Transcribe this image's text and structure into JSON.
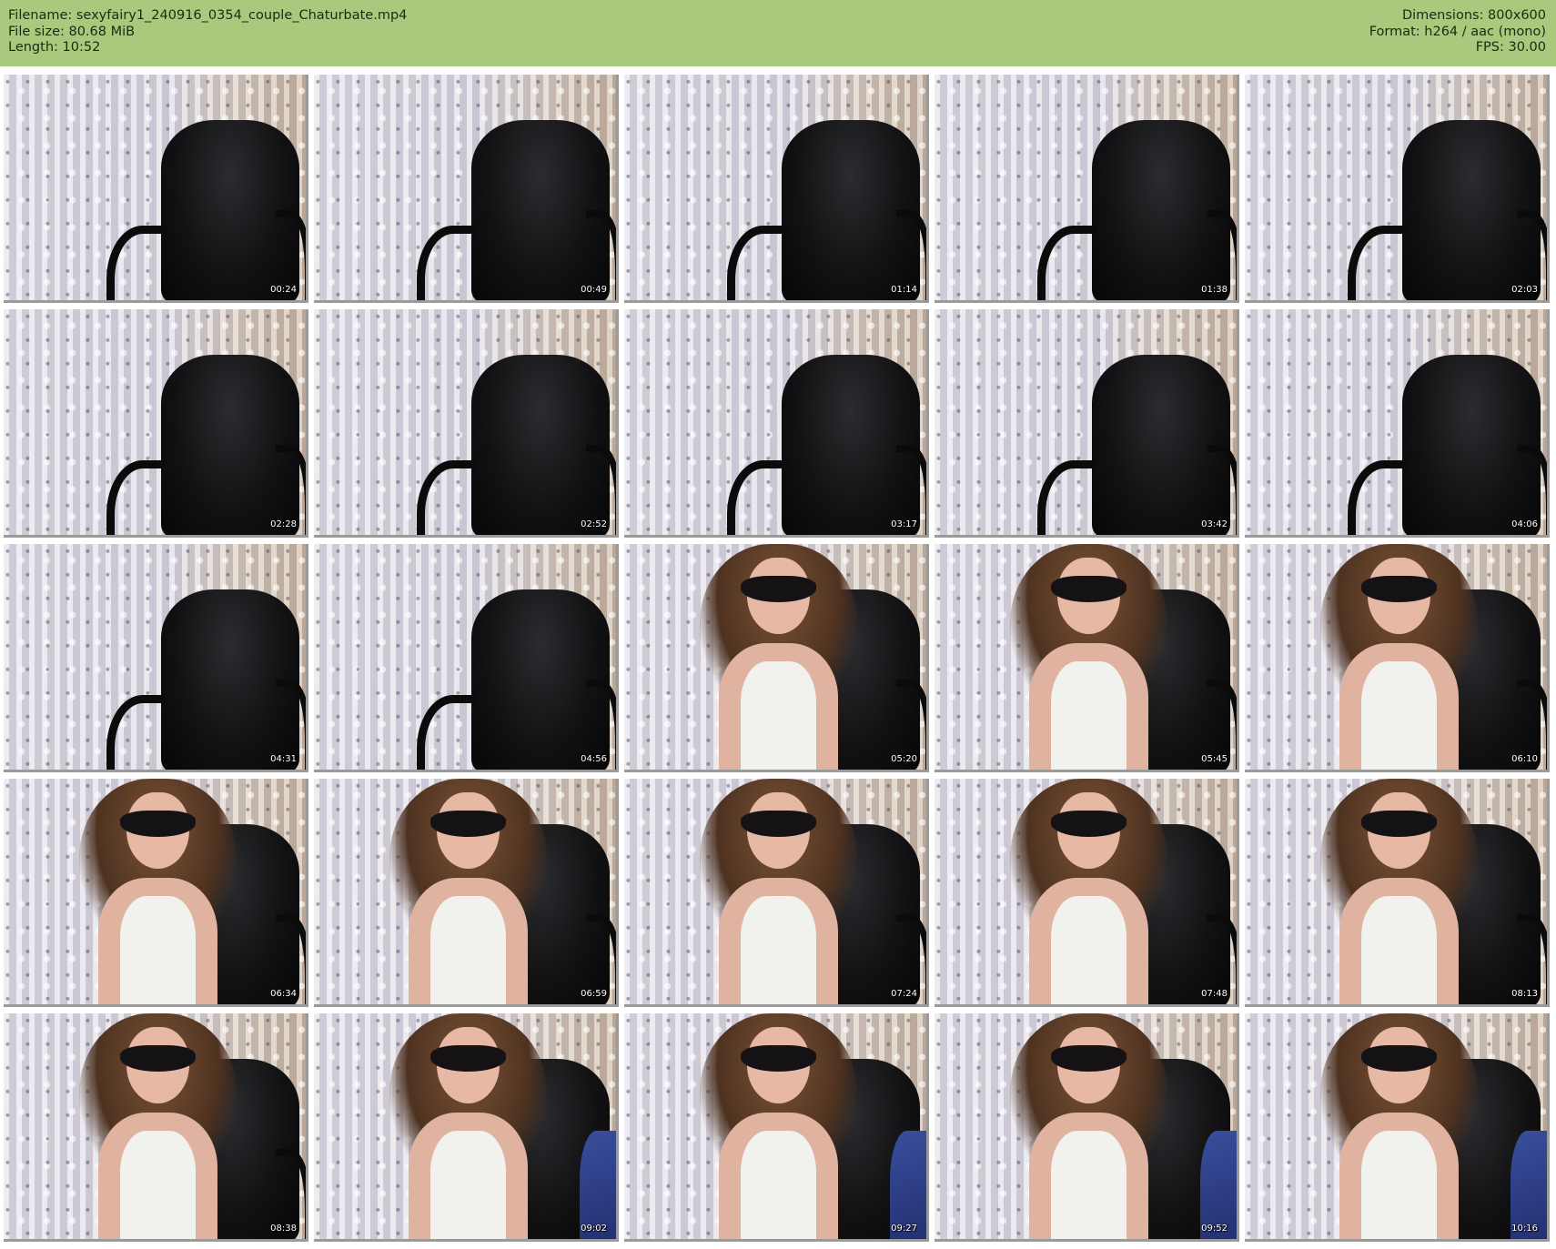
{
  "header": {
    "filename_line": "Filename: sexyfairy1_240916_0354_couple_Chaturbate.mp4",
    "filesize_line": "File size: 80.68 MiB",
    "length_line": "Length: 10:52",
    "dimensions_line": "Dimensions: 800x600",
    "format_line": "Format: h264 / aac (mono)",
    "fps_line": "FPS: 30.00",
    "background_color": "#a9c97c"
  },
  "thumbnails": [
    {
      "time": "00:24",
      "scene": "chair"
    },
    {
      "time": "00:49",
      "scene": "chair"
    },
    {
      "time": "01:14",
      "scene": "chair"
    },
    {
      "time": "01:38",
      "scene": "chair"
    },
    {
      "time": "02:03",
      "scene": "chair"
    },
    {
      "time": "02:28",
      "scene": "chair"
    },
    {
      "time": "02:52",
      "scene": "chair"
    },
    {
      "time": "03:17",
      "scene": "chair"
    },
    {
      "time": "03:42",
      "scene": "chair"
    },
    {
      "time": "04:06",
      "scene": "chair"
    },
    {
      "time": "04:31",
      "scene": "chair"
    },
    {
      "time": "04:56",
      "scene": "chair"
    },
    {
      "time": "05:20",
      "scene": "person"
    },
    {
      "time": "05:45",
      "scene": "person"
    },
    {
      "time": "06:10",
      "scene": "person"
    },
    {
      "time": "06:34",
      "scene": "person"
    },
    {
      "time": "06:59",
      "scene": "person"
    },
    {
      "time": "07:24",
      "scene": "person"
    },
    {
      "time": "07:48",
      "scene": "person"
    },
    {
      "time": "08:13",
      "scene": "person"
    },
    {
      "time": "08:38",
      "scene": "person"
    },
    {
      "time": "09:02",
      "scene": "couple"
    },
    {
      "time": "09:27",
      "scene": "couple"
    },
    {
      "time": "09:52",
      "scene": "couple"
    },
    {
      "time": "10:16",
      "scene": "couple"
    }
  ]
}
